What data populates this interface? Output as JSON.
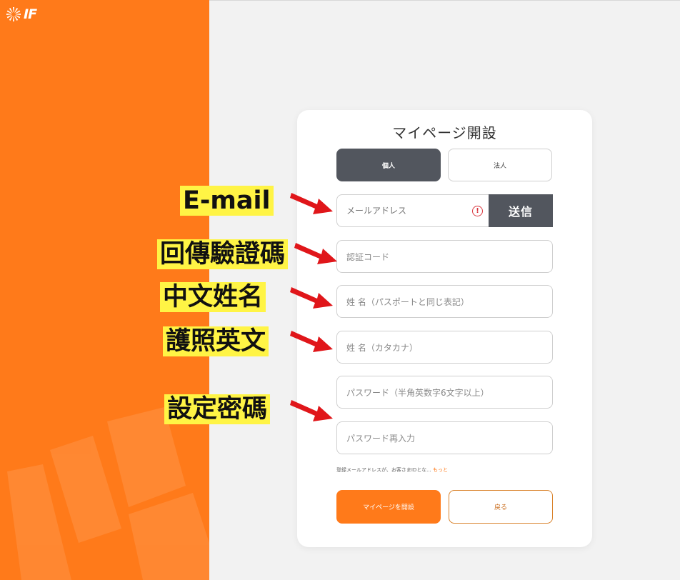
{
  "brand": {
    "logo_text": "IF"
  },
  "form": {
    "title": "マイページ開設",
    "type_individual": "個人",
    "type_corporate": "法人",
    "email_placeholder": "メールアドレス",
    "send_label": "送信",
    "code_placeholder": "認証コード",
    "name_passport_placeholder": "姓  名（パスポートと同じ表記）",
    "name_katakana_placeholder": "姓  名（カタカナ）",
    "password_placeholder": "パスワード（半角英数字6文字以上）",
    "password_confirm_placeholder": "パスワード再入力",
    "notice_text": "登録メールアドレスが、お客さまIDとな...",
    "notice_more": "もっと",
    "open_label": "マイページを開設",
    "back_label": "戻る"
  },
  "annotations": {
    "email": "E-mail",
    "code": "回傳驗證碼",
    "name_zh": "中文姓名",
    "name_en": "護照英文",
    "password": "設定密碼"
  },
  "icons": {
    "error": "error-circle-icon"
  },
  "colors": {
    "brand_orange": "#ff7a1a",
    "dark_button": "#52565e",
    "highlight_yellow": "#fff445",
    "arrow_red": "#e0161a"
  }
}
